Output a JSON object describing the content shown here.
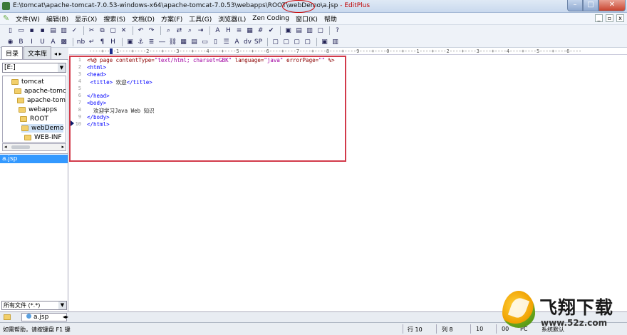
{
  "titlebar": {
    "path": "E:\\tomcat\\apache-tomcat-7.0.53-windows-x64\\apache-tomcat-7.0.53\\webapps\\ROOT\\webDemo\\a.jsp",
    "app_name": " - EditPlus",
    "minimize": "–",
    "maximize": "□",
    "close": "✕"
  },
  "menu": {
    "items": [
      "文件(W)",
      "编辑(B)",
      "显示(X)",
      "搜索(S)",
      "文档(D)",
      "方案(F)",
      "工具(G)",
      "浏览器(L)",
      "Zen Coding",
      "窗口(K)",
      "帮助"
    ],
    "mdi_min": "_",
    "mdi_restore": "▫",
    "mdi_close": "x"
  },
  "left_panel": {
    "tabs": [
      "目录",
      "文本库"
    ],
    "tab_arrows": "◂ ▸",
    "drive": "[E:]",
    "tree": [
      "tomcat",
      "apache-tomc",
      "apache-tom",
      "webapps",
      "ROOT",
      "webDemo",
      "WEB-INF"
    ],
    "files": [
      "a.jsp"
    ],
    "filter": "所有文件 (*.*)"
  },
  "ruler": {
    "text": "----+----1----+----2----+----3----+----4----+----5----+----6----+----7----+----8----+----9----+----0----+----1----+----2----+----3----+----4----+----5----+----6----"
  },
  "editor": {
    "line_numbers": [
      "1",
      "2",
      "3",
      "4",
      "5",
      "6",
      "7",
      "8",
      "9",
      "10"
    ],
    "lines": [
      {
        "a": "<%@ page contentType=",
        "b": "\"text/html; charset=GBK\"",
        "c": " language=",
        "d": "\"java\"",
        "e": " errorPage=",
        "f": "\"\"",
        "g": " %>"
      },
      {
        "a": "<html>"
      },
      {
        "a": "<head>"
      },
      {
        "a": " <title>",
        "b": " 欢迎",
        "c": "</title>"
      },
      {
        "a": ""
      },
      {
        "a": "</head>"
      },
      {
        "a": "<body>"
      },
      {
        "a": "  欢迎学习Java Web 知识"
      },
      {
        "a": "</body>"
      },
      {
        "a": "</html>"
      }
    ]
  },
  "doc_tabs": {
    "active": "a.jsp",
    "nav": "◂▸"
  },
  "status": {
    "help": "如需帮助，请按键盘 F1 键",
    "line": "行 10",
    "col": "列 8",
    "n1": "10",
    "n2": "00",
    "mode": "PC",
    "encoding": "系统默认"
  },
  "watermark": {
    "name": "飞翔下载",
    "url": "www.52z.com"
  }
}
